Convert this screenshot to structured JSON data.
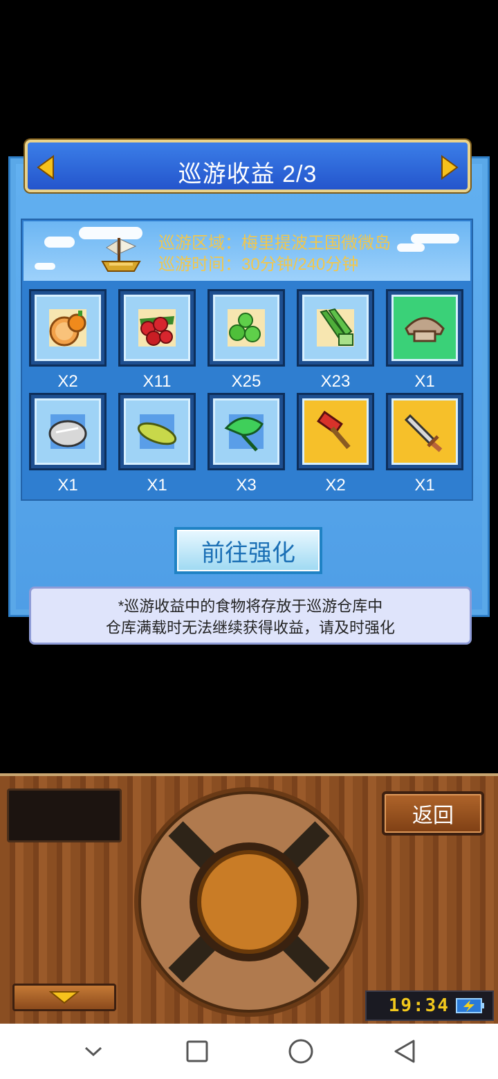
{
  "header": {
    "title": "巡游收益 2/3"
  },
  "banner": {
    "line1": "巡游区域：梅里提波王国微微岛",
    "line2": "巡游时间：30分钟/240分钟"
  },
  "items": [
    {
      "icon": "orange-icon",
      "qty": "X2"
    },
    {
      "icon": "berries-icon",
      "qty": "X11"
    },
    {
      "icon": "green-beans-icon",
      "qty": "X25"
    },
    {
      "icon": "scallion-icon",
      "qty": "X23"
    },
    {
      "icon": "mushroom-icon",
      "qty": "X1"
    },
    {
      "icon": "rock-icon",
      "qty": "X1"
    },
    {
      "icon": "corn-icon",
      "qty": "X1"
    },
    {
      "icon": "leaf-icon",
      "qty": "X3"
    },
    {
      "icon": "hammer-icon",
      "qty": "X2"
    },
    {
      "icon": "sword-icon",
      "qty": "X1"
    }
  ],
  "enhance_button": "前往强化",
  "notice": {
    "line1": "*巡游收益中的食物将存放于巡游仓库中",
    "line2": "仓库满载时无法继续获得收益，请及时强化"
  },
  "console": {
    "back_label": "返回",
    "clock": "19:34"
  },
  "colors": {
    "title_bar": "#2f66d8",
    "banner_text": "#f2c74c",
    "clock_text": "#f2c81c"
  }
}
